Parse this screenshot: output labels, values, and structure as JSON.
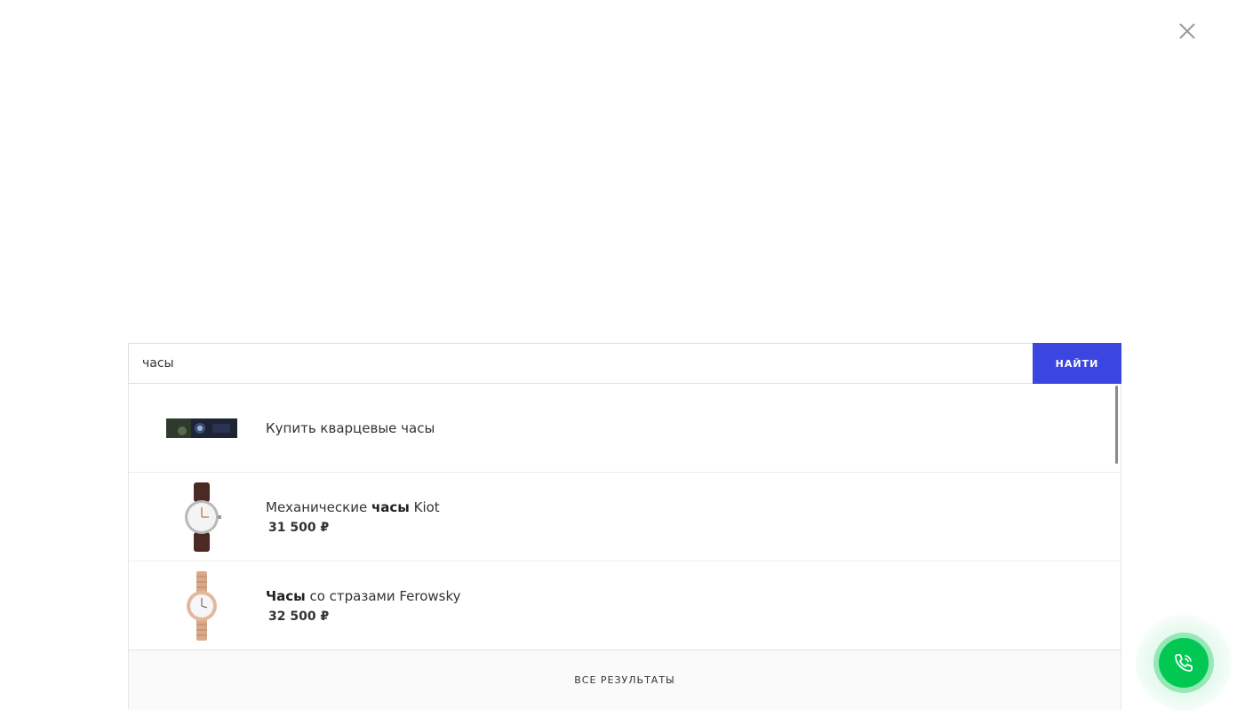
{
  "search": {
    "value": "часы",
    "button_label": "НАЙТИ"
  },
  "results": [
    {
      "title_parts": [
        {
          "text": "Купить кварцевые часы",
          "bold": false
        }
      ],
      "price": "",
      "thumb_icon": "product-banner-image"
    },
    {
      "title_parts": [
        {
          "text": "Механические ",
          "bold": false
        },
        {
          "text": "часы",
          "bold": true
        },
        {
          "text": " Kiot",
          "bold": false
        }
      ],
      "price": "31 500 ₽",
      "thumb_icon": "leather-watch-image"
    },
    {
      "title_parts": [
        {
          "text": "Часы",
          "bold": true
        },
        {
          "text": " со стразами Ferowsky",
          "bold": false
        }
      ],
      "price": "32 500 ₽",
      "thumb_icon": "bracelet-watch-image"
    }
  ],
  "all_results_label": "ВСЕ РЕЗУЛЬТАТЫ",
  "colors": {
    "accent": "#3b46e0",
    "call": "#00c853"
  }
}
